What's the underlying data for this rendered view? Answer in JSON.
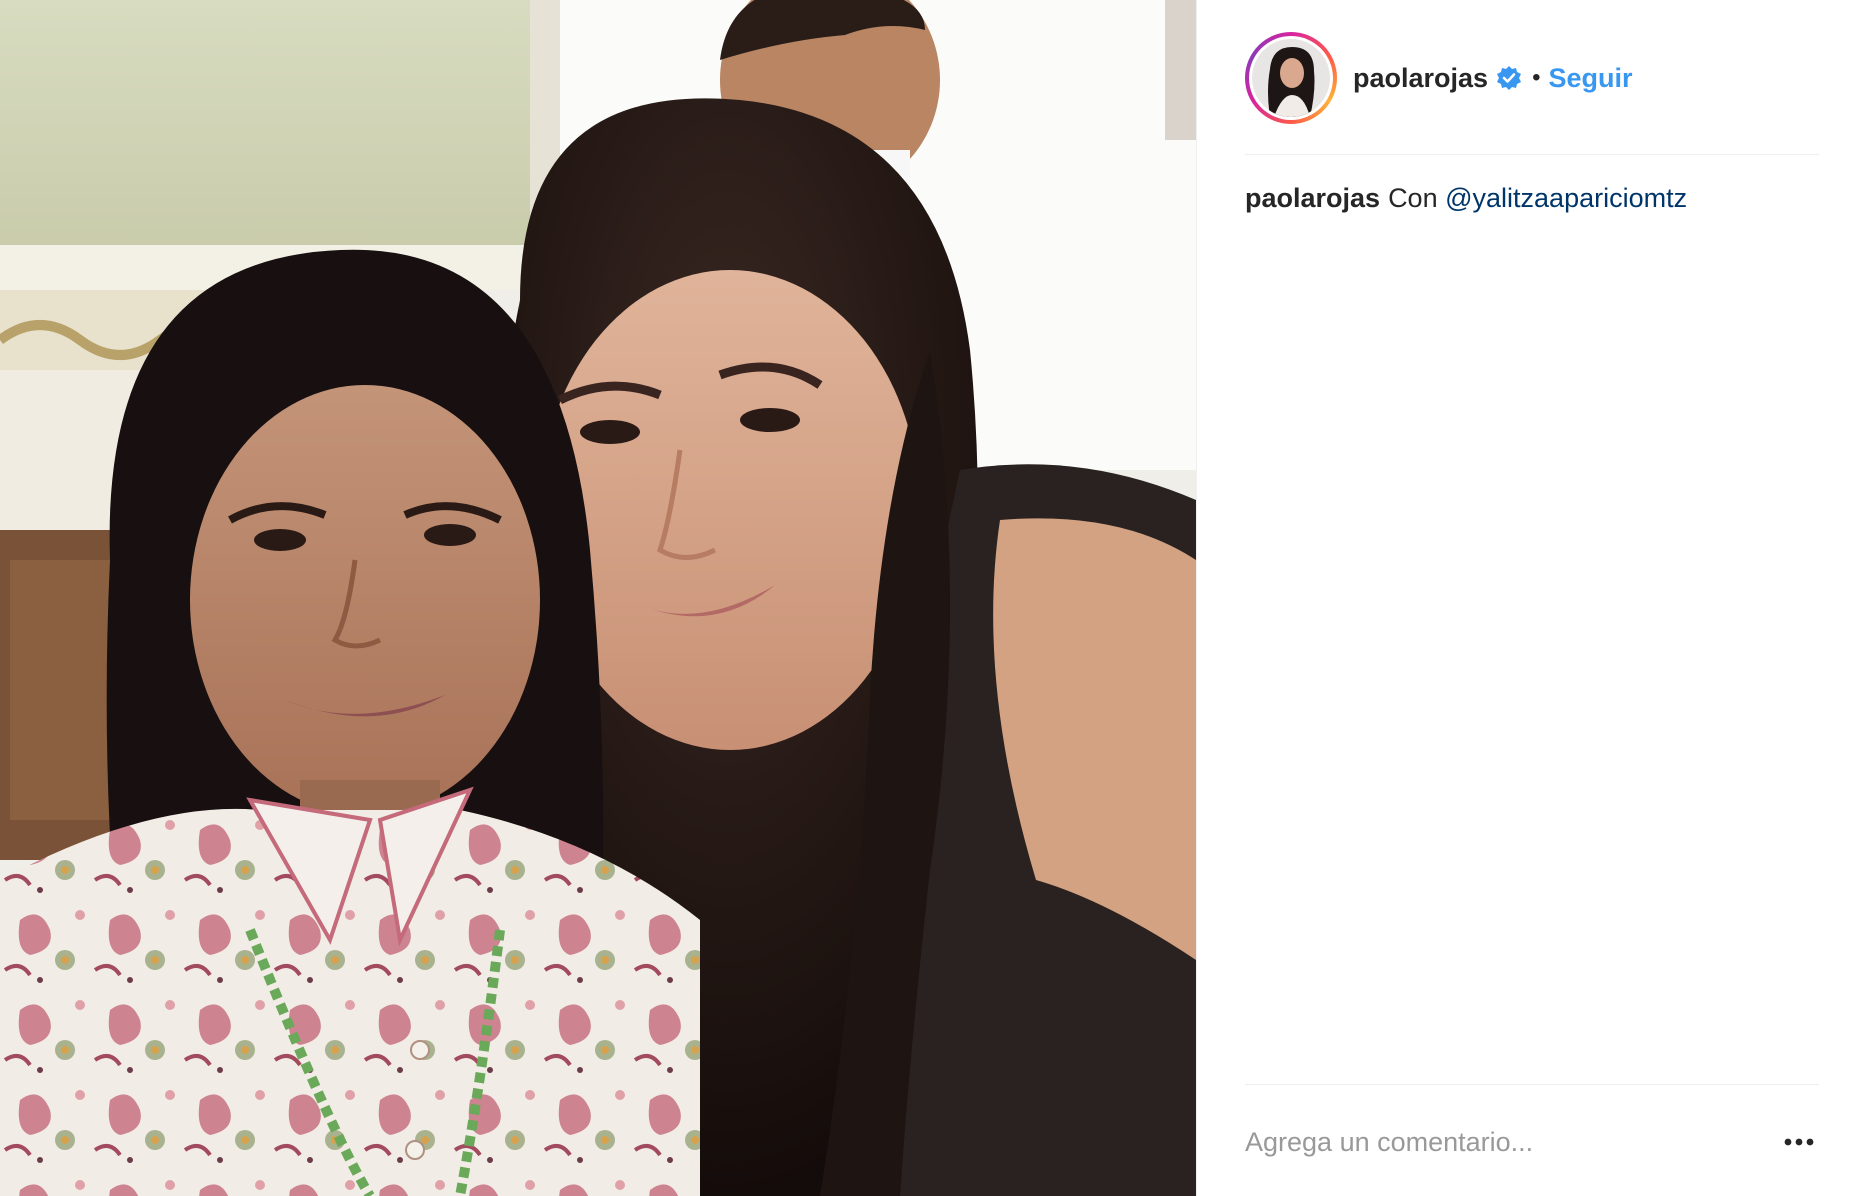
{
  "header": {
    "username": "paolarojas",
    "separator": "•",
    "follow_label": "Seguir",
    "verified_icon": "verified-badge-icon"
  },
  "caption": {
    "username": "paolarojas",
    "text": "Con",
    "mention": "@yalitzaapariciomtz"
  },
  "comment": {
    "placeholder": "Agrega un comentario...",
    "more_icon": "more-options-icon"
  },
  "colors": {
    "link_blue": "#3897f0",
    "mention_blue": "#003569",
    "text": "#262626",
    "verified_blue": "#3897f0"
  }
}
